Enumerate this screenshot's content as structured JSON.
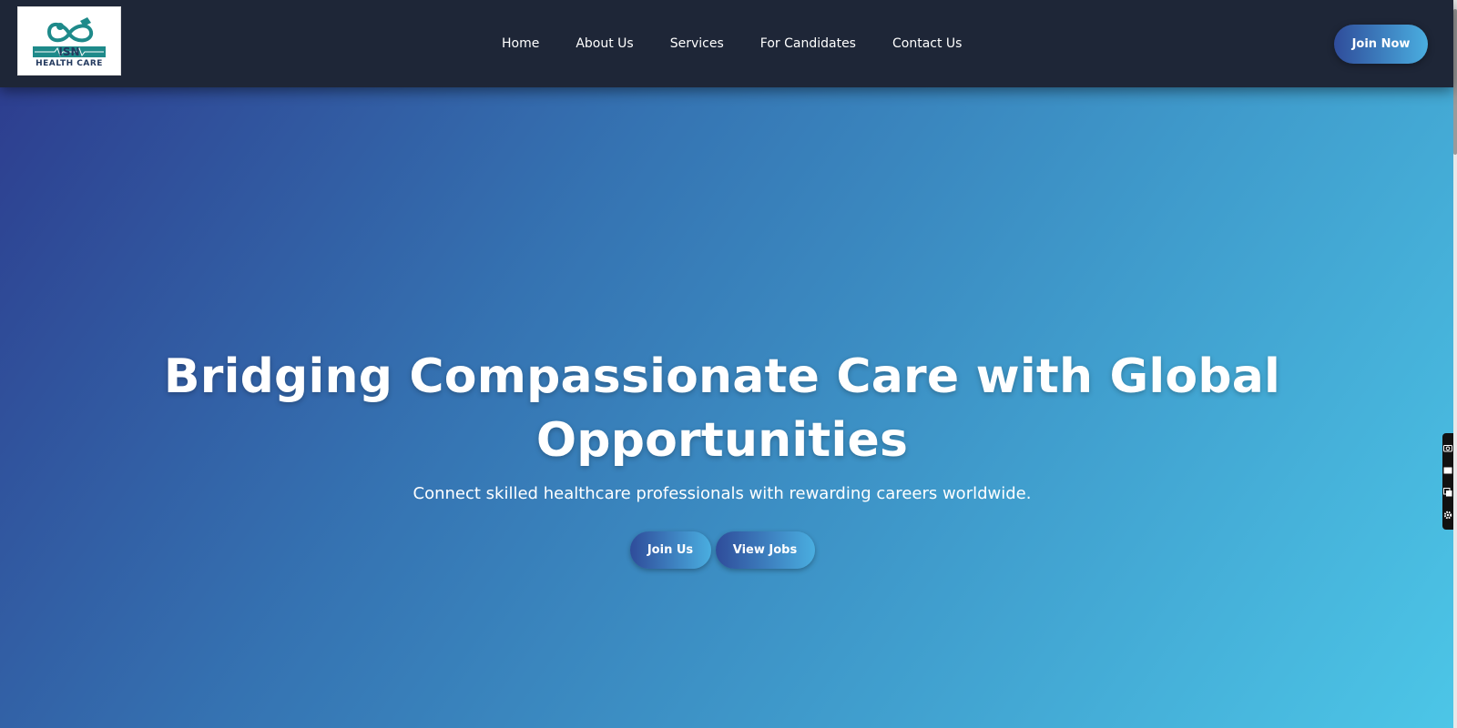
{
  "header": {
    "logo_text": "HEALTH CARE",
    "logo_abbr": "ISN",
    "nav": [
      {
        "label": "Home"
      },
      {
        "label": "About Us"
      },
      {
        "label": "Services"
      },
      {
        "label": "For Candidates"
      },
      {
        "label": "Contact Us"
      }
    ],
    "cta_label": "Join Now"
  },
  "hero": {
    "title": "Bridging Compassionate Care with Global Opportunities",
    "subtitle": "Connect skilled healthcare professionals with rewarding careers worldwide.",
    "buttons": [
      {
        "label": "Join Us"
      },
      {
        "label": "View Jobs"
      }
    ]
  },
  "side_tools": [
    "camera-icon",
    "rectangle-icon",
    "copy-icon",
    "gear-icon"
  ],
  "colors": {
    "header_bg": "#1e2637",
    "gradient_start": "#2d3e8f",
    "gradient_end": "#4cc6e7",
    "button_start": "#2f4c9a",
    "button_end": "#4aaee0",
    "logo_teal": "#1e8a8a"
  }
}
